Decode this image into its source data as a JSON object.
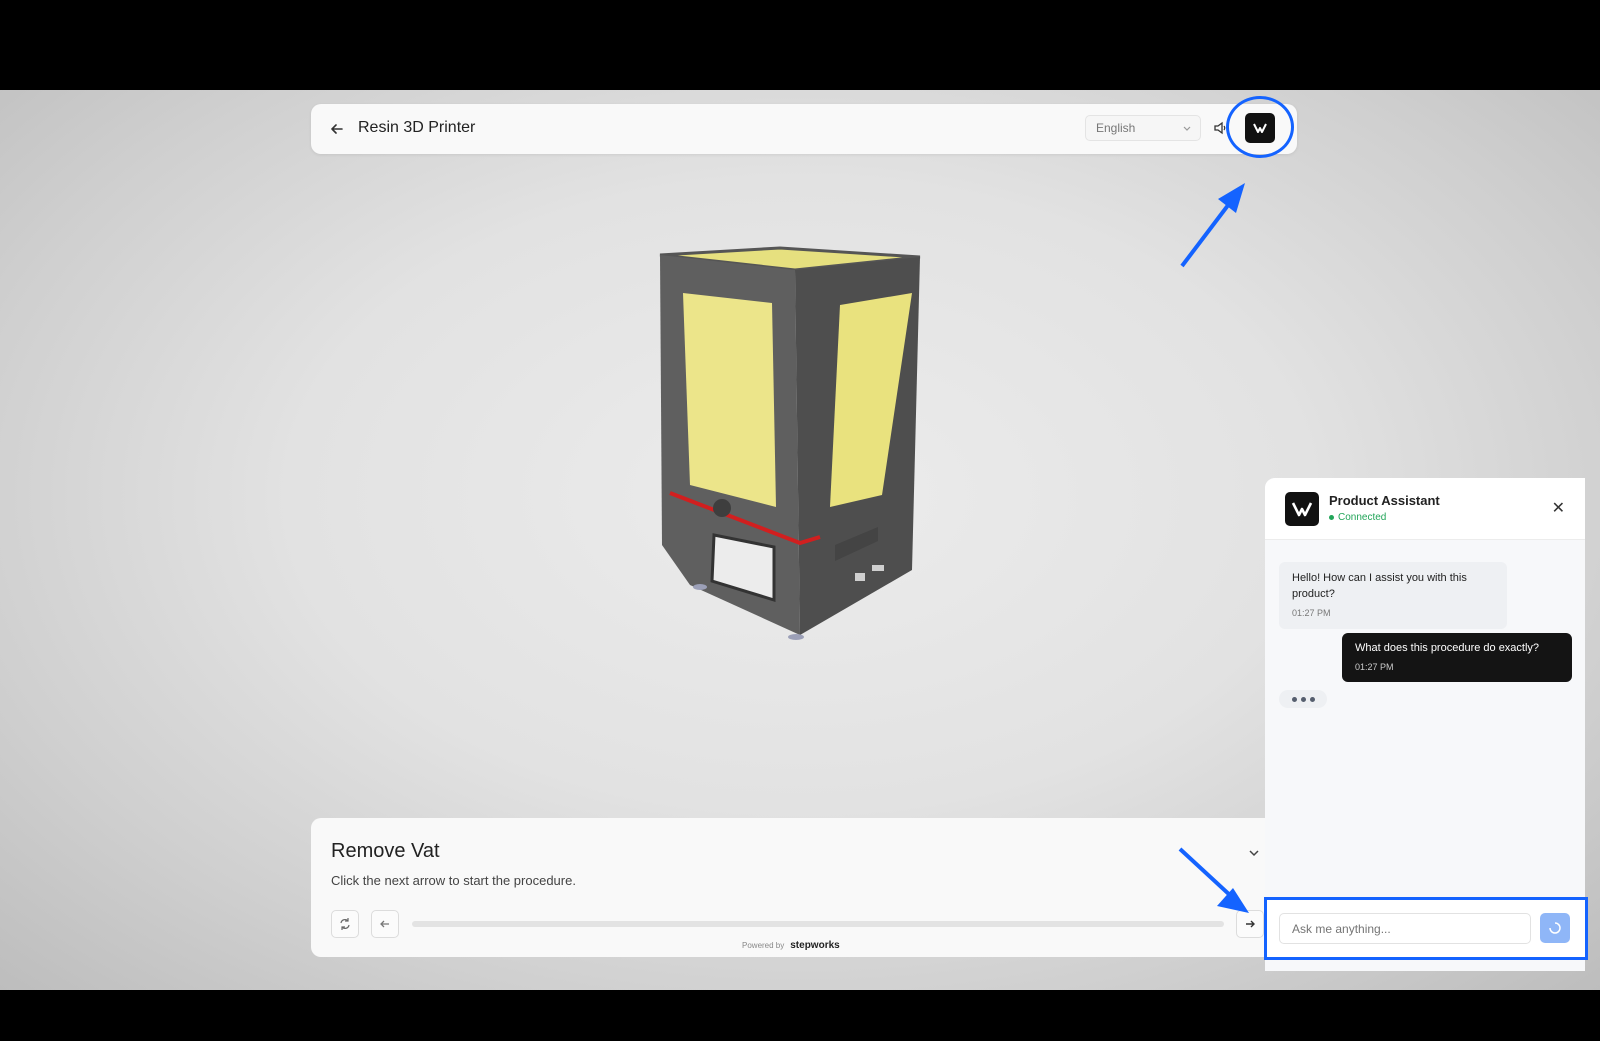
{
  "header": {
    "title": "Resin 3D Printer",
    "language": "English"
  },
  "step": {
    "title": "Remove Vat",
    "description": "Click the next arrow to start the procedure.",
    "powered_by": "Powered by",
    "brand": "stepworks"
  },
  "chat": {
    "name": "Product Assistant",
    "status": "Connected",
    "messages": [
      {
        "from": "assistant",
        "text": "Hello! How can I assist you with this product?",
        "time": "01:27 PM"
      },
      {
        "from": "user",
        "text": "What does this procedure do exactly?",
        "time": "01:27 PM"
      }
    ],
    "input_placeholder": "Ask me anything..."
  },
  "colors": {
    "highlight": "#1463ff",
    "printer_window": "#ece58a",
    "status_green": "#22a559"
  }
}
